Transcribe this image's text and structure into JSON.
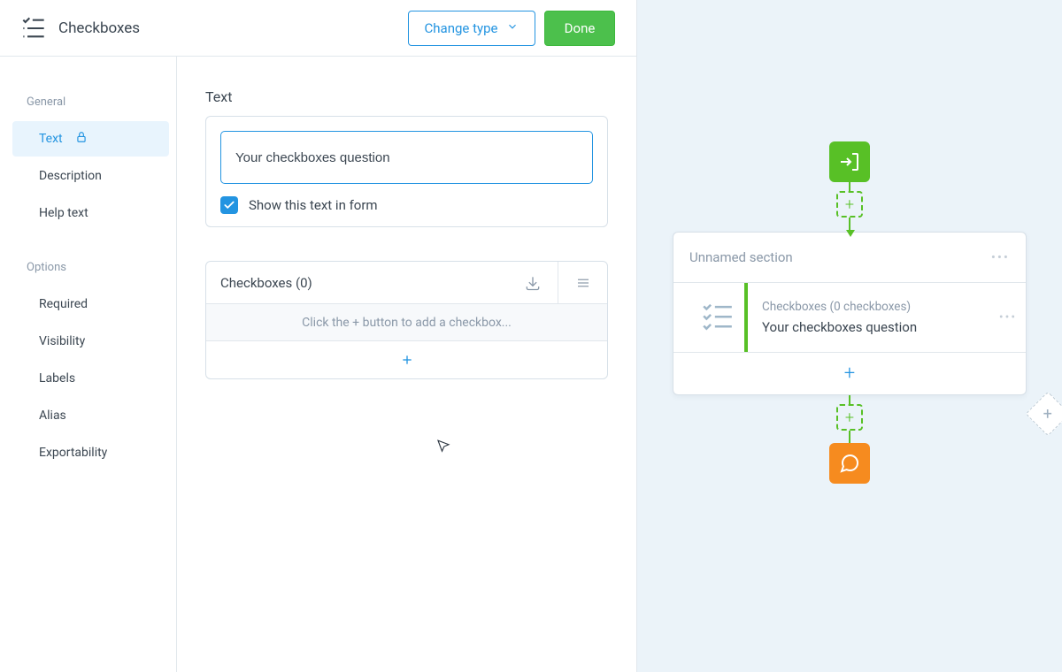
{
  "header": {
    "title": "Checkboxes",
    "change_type_label": "Change type",
    "done_label": "Done"
  },
  "sidebar": {
    "group_general": "General",
    "items_general": [
      "Text",
      "Description",
      "Help text"
    ],
    "group_options": "Options",
    "items_options": [
      "Required",
      "Visibility",
      "Labels",
      "Alias",
      "Exportability"
    ],
    "active": "Text"
  },
  "main": {
    "text_section_label": "Text",
    "question_text": "Your checkboxes question",
    "show_text_label": "Show this text in form",
    "show_text_checked": true,
    "checkboxes_panel_title": "Checkboxes (0)",
    "checkboxes_hint": "Click the + button to add a checkbox..."
  },
  "canvas": {
    "section_title": "Unnamed section",
    "question": {
      "meta": "Checkboxes (0 checkboxes)",
      "title": "Your checkboxes question"
    }
  }
}
